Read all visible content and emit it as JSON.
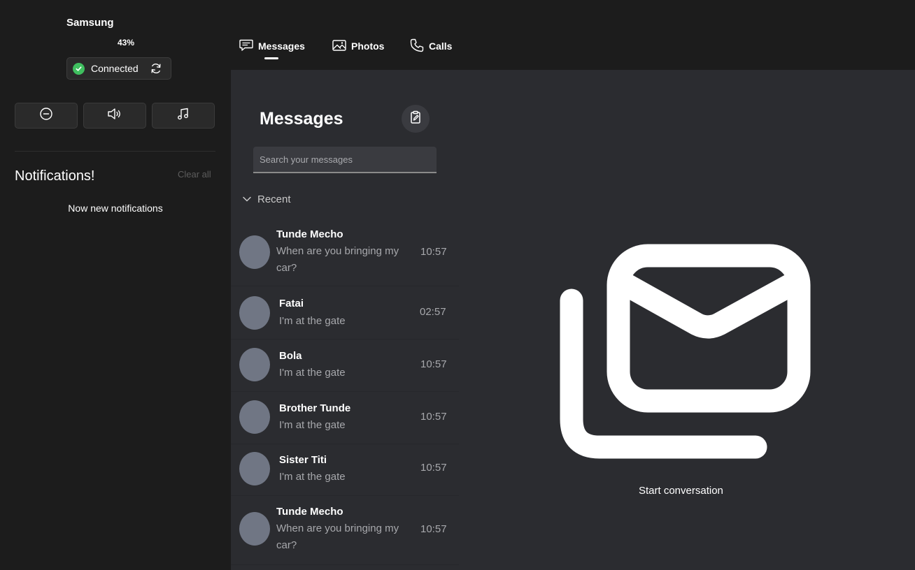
{
  "device": {
    "name": "Samsung",
    "battery": "43%",
    "status": "Connected"
  },
  "quick_actions": [
    {
      "name": "do-not-disturb",
      "icon": "minus-circle-icon"
    },
    {
      "name": "volume",
      "icon": "speaker-icon"
    },
    {
      "name": "media",
      "icon": "music-note-icon"
    }
  ],
  "notifications": {
    "title": "Notifications!",
    "clear_label": "Clear all",
    "empty_text": "Now new notifications"
  },
  "tabs": [
    {
      "label": "Messages",
      "icon": "chat-icon",
      "active": true
    },
    {
      "label": "Photos",
      "icon": "image-icon",
      "active": false
    },
    {
      "label": "Calls",
      "icon": "phone-icon",
      "active": false
    }
  ],
  "messages": {
    "heading": "Messages",
    "search_placeholder": "Search your messages",
    "section": "Recent",
    "conversations": [
      {
        "name": "Tunde Mecho",
        "preview": "When are you bringing my car?",
        "time": "10:57"
      },
      {
        "name": "Fatai",
        "preview": "I'm at the gate",
        "time": "02:57"
      },
      {
        "name": "Bola",
        "preview": "I'm at the gate",
        "time": "10:57"
      },
      {
        "name": "Brother Tunde",
        "preview": "I'm at the gate",
        "time": "10:57"
      },
      {
        "name": "Sister Titi",
        "preview": "I'm at the gate",
        "time": "10:57"
      },
      {
        "name": "Tunde Mecho",
        "preview": "When are you bringing my car?",
        "time": "10:57"
      }
    ]
  },
  "empty_state": {
    "label": "Start conversation",
    "icon": "mail-stack-icon"
  },
  "colors": {
    "sidebar_bg": "#1c1c1c",
    "panel_bg": "#2b2c30",
    "connected_green": "#3fbf5f",
    "avatar_gray": "#707684"
  }
}
